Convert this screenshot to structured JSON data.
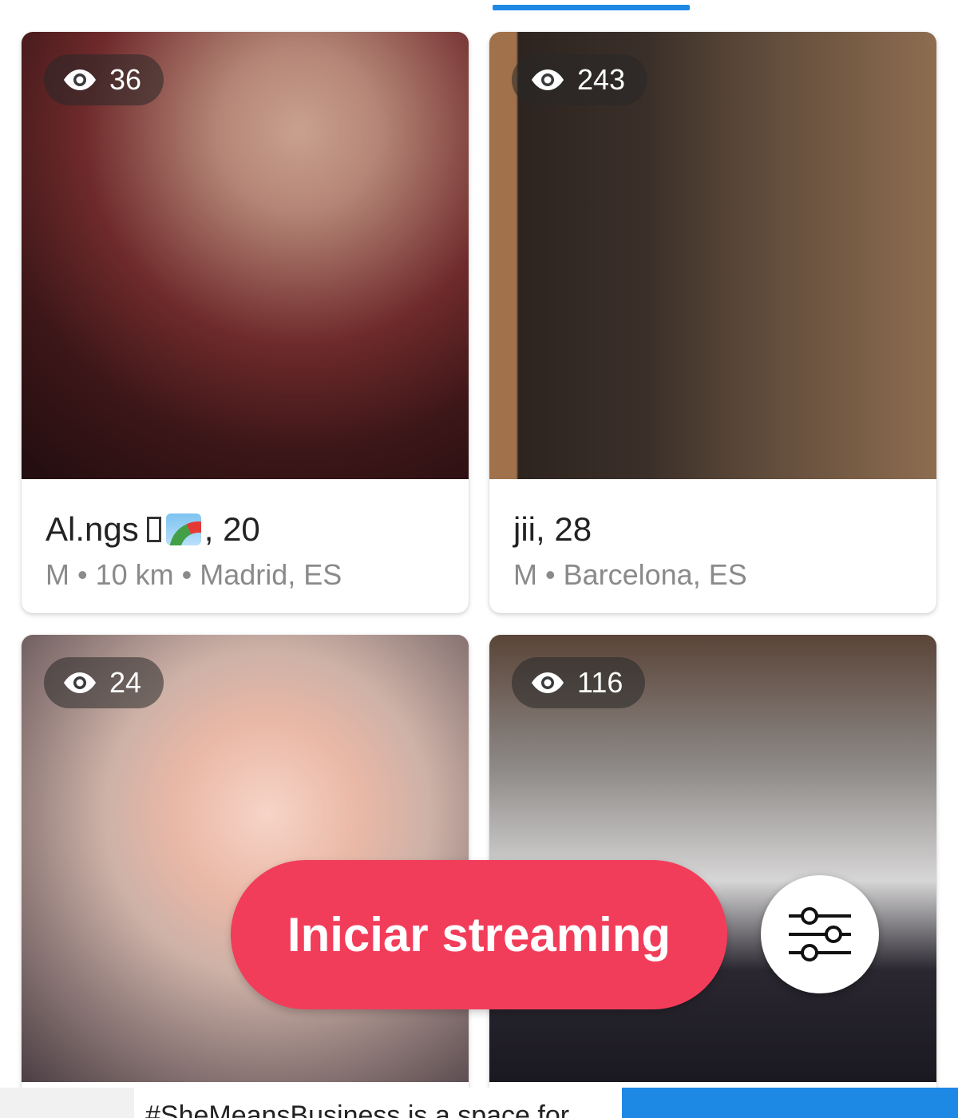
{
  "cards": [
    {
      "views": "36",
      "name": "Al.ngs",
      "age_suffix": ", 20",
      "meta": "M • 10 km • Madrid, ES"
    },
    {
      "views": "243",
      "name": "jii, 28",
      "meta": "M • Barcelona, ES"
    },
    {
      "views": "24"
    },
    {
      "views": "116"
    }
  ],
  "cta": {
    "label": "Iniciar streaming",
    "color": "#f23d5a"
  },
  "filter": {
    "icon": "sliders-icon"
  },
  "ad": {
    "text": "#SheMeansBusiness is a space for"
  },
  "colors": {
    "accent": "#1e88e5",
    "cta": "#f23d5a"
  }
}
